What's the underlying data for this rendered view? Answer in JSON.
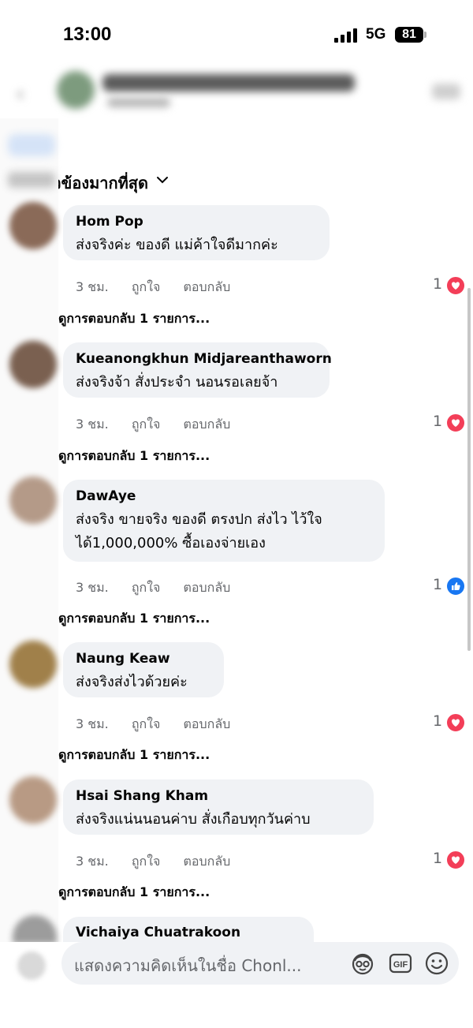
{
  "status_bar": {
    "time": "13:00",
    "network": "5G",
    "battery": "81",
    "icons": [
      "cellular-signal-icon",
      "battery-icon"
    ]
  },
  "sort": {
    "label": "ที่เกี่ยวข้องมากที่สุด",
    "icon": "chevron-down-icon"
  },
  "comments": [
    {
      "name": "Hom Pop",
      "text": "ส่งจริงค่ะ ของดี แม่ค้าใจดีมากค่ะ",
      "time": "3 ชม.",
      "like_label": "ถูกใจ",
      "reply_label": "ตอบกลับ",
      "reaction_count": "1",
      "reaction": "love",
      "view_replies": "ดูการตอบกลับ 1 รายการ..."
    },
    {
      "name": "Kueanongkhun Midjareanthaworn",
      "text": "ส่งจริงจ้า สั่งประจำ นอนรอเลยจ้า",
      "time": "3 ชม.",
      "like_label": "ถูกใจ",
      "reply_label": "ตอบกลับ",
      "reaction_count": "1",
      "reaction": "love",
      "view_replies": "ดูการตอบกลับ 1 รายการ..."
    },
    {
      "name": "DawAye",
      "text_line1": "ส่งจริง ขายจริง ของดี ตรงปก ส่งไว ไว้ใจ",
      "text_line2": "ได้1,000,000% ซื้อเองจ่ายเอง",
      "time": "3 ชม.",
      "like_label": "ถูกใจ",
      "reply_label": "ตอบกลับ",
      "reaction_count": "1",
      "reaction": "like",
      "view_replies": "ดูการตอบกลับ 1 รายการ..."
    },
    {
      "name": "Naung Keaw",
      "text": "ส่งจริงส่งไวด้วยค่ะ",
      "time": "3 ชม.",
      "like_label": "ถูกใจ",
      "reply_label": "ตอบกลับ",
      "reaction_count": "1",
      "reaction": "love",
      "view_replies": "ดูการตอบกลับ 1 รายการ..."
    },
    {
      "name": "Hsai Shang Kham",
      "text": "ส่งจริงแน่นนอนค่าบ สั่งเกือบทุกวันค่าบ",
      "time": "3 ชม.",
      "like_label": "ถูกใจ",
      "reply_label": "ตอบกลับ",
      "reaction_count": "1",
      "reaction": "love",
      "view_replies": "ดูการตอบกลับ 1 รายการ..."
    },
    {
      "name": "Vichaiya Chuatrakoon"
    }
  ],
  "composer": {
    "placeholder": "แสดงความคิดเห็นในชื่อ Chonl...",
    "icons": [
      "avatar-sticker-icon",
      "gif-icon",
      "emoji-icon"
    ]
  },
  "colors": {
    "love": "#f33e58",
    "like": "#1877f2",
    "bubble": "#f0f2f5",
    "meta_text": "#65676b"
  }
}
